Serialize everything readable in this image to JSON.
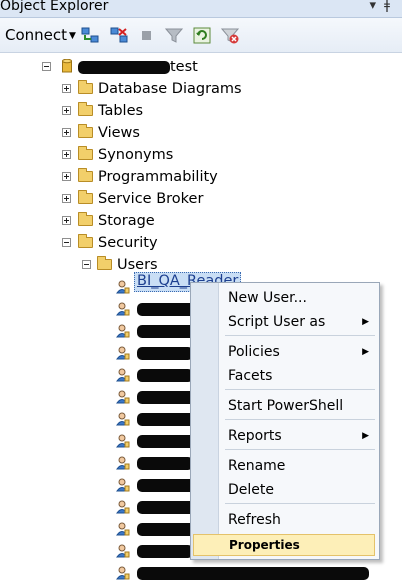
{
  "window": {
    "title": "Object Explorer"
  },
  "toolbar": {
    "connect_label": "Connect",
    "buttons": [
      "connect-object-explorer-icon",
      "disconnect-icon",
      "stop-icon",
      "filter-icon",
      "refresh-icon",
      "clear-filter-icon"
    ]
  },
  "tree": {
    "database": {
      "name_suffix": "test",
      "name_redacted": true
    },
    "folders": [
      {
        "label": "Database Diagrams",
        "expanded": false
      },
      {
        "label": "Tables",
        "expanded": false
      },
      {
        "label": "Views",
        "expanded": false
      },
      {
        "label": "Synonyms",
        "expanded": false
      },
      {
        "label": "Programmability",
        "expanded": false
      },
      {
        "label": "Service Broker",
        "expanded": false
      },
      {
        "label": "Storage",
        "expanded": false
      },
      {
        "label": "Security",
        "expanded": true
      }
    ],
    "users_folder": {
      "label": "Users",
      "expanded": true
    },
    "selected_user": "BI_QA_Reader",
    "redacted_user_count": 13
  },
  "context_menu": {
    "items": [
      {
        "label": "New User...",
        "submenu": false
      },
      {
        "label": "Script User as",
        "submenu": true
      },
      {
        "label": "Policies",
        "submenu": true
      },
      {
        "label": "Facets",
        "submenu": false
      },
      {
        "label": "Start PowerShell",
        "submenu": false
      },
      {
        "label": "Reports",
        "submenu": true
      },
      {
        "label": "Rename",
        "submenu": false
      },
      {
        "label": "Delete",
        "submenu": false
      },
      {
        "label": "Refresh",
        "submenu": false
      },
      {
        "label": "Properties",
        "submenu": false,
        "highlighted": true
      }
    ]
  }
}
